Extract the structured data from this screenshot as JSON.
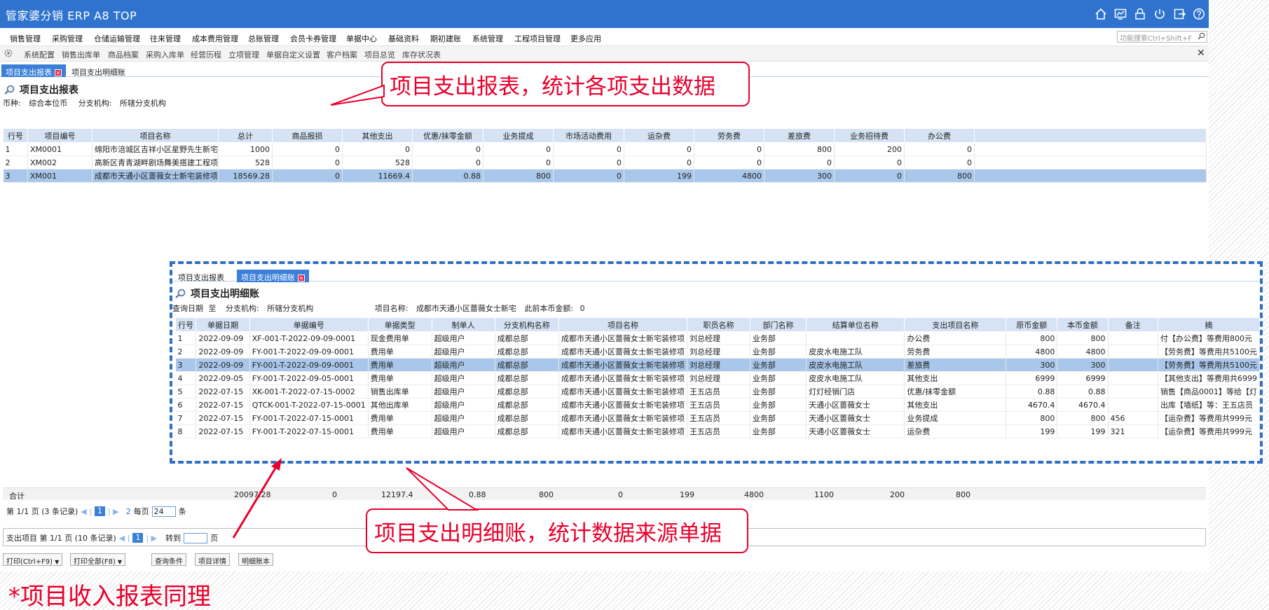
{
  "app": {
    "title": "管家婆分销 ERP A8 TOP"
  },
  "topbar_icons": [
    "home-icon",
    "chart-icon",
    "lock-icon",
    "power-icon",
    "logout-icon",
    "help-icon"
  ],
  "menu": [
    "销售管理",
    "采购管理",
    "仓储运输管理",
    "往来管理",
    "成本费用管理",
    "总账管理",
    "会员卡券管理",
    "单据中心",
    "基础资料",
    "期初建账",
    "系统管理",
    "工程项目管理",
    "更多应用"
  ],
  "search": {
    "placeholder": "功能搜索Ctrl+Shift+F"
  },
  "quickbar": [
    "系统配置",
    "销售出库单",
    "商品档案",
    "采购入库单",
    "经营历程",
    "立项管理",
    "单据自定义设置",
    "客户档案",
    "项目总览",
    "库存状况表"
  ],
  "tabs": [
    "项目支出报表",
    "项目支出明细账"
  ],
  "report": {
    "title": "项目支出报表",
    "filter": {
      "currency_label": "币种:",
      "currency": "综合本位币",
      "branch_label": "分支机构:",
      "branch": "所辖分支机构"
    },
    "columns": [
      "行号",
      "项目编号",
      "项目名称",
      "总计",
      "商品报损",
      "其他支出",
      "优惠/抹零金额",
      "业务提成",
      "市场活动费用",
      "运杂费",
      "劳务费",
      "差旅费",
      "业务招待费",
      "办公费"
    ],
    "rows": [
      [
        "1",
        "XM0001",
        "绵阳市涪城区吉祥小区星野先生新宅",
        "1000",
        "0",
        "0",
        "0",
        "0",
        "0",
        "0",
        "0",
        "800",
        "200",
        "0"
      ],
      [
        "2",
        "XM002",
        "高新区青青湖畔剧场舞美搭建工程项",
        "528",
        "0",
        "528",
        "0",
        "0",
        "0",
        "0",
        "0",
        "0",
        "0",
        "0"
      ],
      [
        "3",
        "XM001",
        "成都市天通小区蔷薇女士新宅装修项",
        "18569.28",
        "0",
        "11669.4",
        "0.88",
        "800",
        "0",
        "199",
        "4800",
        "300",
        "0",
        "800"
      ]
    ],
    "selected_row": 2,
    "totals": {
      "label": "合计",
      "total": "20097.28",
      "loss": "0",
      "other": "12197.4",
      "promo": "0.88",
      "commission": "800",
      "market": "0",
      "freight": "199",
      "labor": "4800",
      "travel": "1100",
      "entertain": "200",
      "office": "800"
    },
    "pager": {
      "page_text": "第 1/1 页 (3 条记录)",
      "page": "1",
      "refresh": "2",
      "per_page_label": "每页",
      "per_page": "24",
      "per_page_unit": "条"
    }
  },
  "detail": {
    "tabs": [
      "项目支出报表",
      "项目支出明细账"
    ],
    "title": "项目支出明细账",
    "filter": {
      "date_label": "查询日期",
      "date_to": "至",
      "branch_label": "分支机构:",
      "branch": "所辖分支机构",
      "project_label": "项目名称:",
      "project": "成都市天通小区蔷薇女士新宅",
      "prev_label": "此前本币金额:",
      "prev_amount": "0"
    },
    "columns": [
      "行号",
      "单据日期",
      "单据编号",
      "单据类型",
      "制单人",
      "分支机构名称",
      "项目名称",
      "职员名称",
      "部门名称",
      "结算单位名称",
      "支出项目名称",
      "原币金额",
      "本币金额",
      "备注",
      "摘"
    ],
    "rows": [
      [
        "1",
        "2022-09-09",
        "XF-001-T-2022-09-09-0001",
        "现金费用单",
        "超级用户",
        "成都总部",
        "成都市天通小区蔷薇女士新宅装修项",
        "刘总经理",
        "业务部",
        "",
        "办公费",
        "800",
        "800",
        "",
        "付【办公费】等费用800元"
      ],
      [
        "2",
        "2022-09-09",
        "FY-001-T-2022-09-09-0001",
        "费用单",
        "超级用户",
        "成都总部",
        "成都市天通小区蔷薇女士新宅装修项",
        "刘总经理",
        "业务部",
        "皮皮水电施工队",
        "劳务费",
        "4800",
        "4800",
        "",
        "【劳务费】等费用共5100元"
      ],
      [
        "3",
        "2022-09-09",
        "FY-001-T-2022-09-09-0001",
        "费用单",
        "超级用户",
        "成都总部",
        "成都市天通小区蔷薇女士新宅装修项",
        "刘总经理",
        "业务部",
        "皮皮水电施工队",
        "差旅费",
        "300",
        "300",
        "",
        "【劳务费】等费用共5100元"
      ],
      [
        "4",
        "2022-09-05",
        "FY-001-T-2022-09-05-0001",
        "费用单",
        "超级用户",
        "成都总部",
        "成都市天通小区蔷薇女士新宅装修项",
        "刘总经理",
        "业务部",
        "皮皮水电施工队",
        "其他支出",
        "6999",
        "6999",
        "",
        "【其他支出】等费用共6999"
      ],
      [
        "5",
        "2022-07-15",
        "XK-001-T-2022-07-15-0002",
        "销售出库单",
        "超级用户",
        "成都总部",
        "成都市天通小区蔷薇女士新宅装修项",
        "王五店员",
        "业务部",
        "灯灯经销门店",
        "优惠/抹零金额",
        "0.88",
        "0.88",
        "",
        "销售【商品0001】等给【灯"
      ],
      [
        "6",
        "2022-07-15",
        "QTCK-001-T-2022-07-15-0001",
        "其他出库单",
        "超级用户",
        "成都总部",
        "成都市天通小区蔷薇女士新宅装修项",
        "王五店员",
        "业务部",
        "天通小区蔷薇女士",
        "其他支出",
        "4670.4",
        "4670.4",
        "",
        "出库【墙纸】等：王五店员"
      ],
      [
        "7",
        "2022-07-15",
        "FY-001-T-2022-07-15-0001",
        "费用单",
        "超级用户",
        "成都总部",
        "成都市天通小区蔷薇女士新宅装修项",
        "王五店员",
        "业务部",
        "天通小区蔷薇女士",
        "业务提成",
        "800",
        "800",
        "456",
        "【运杂费】等费用共999元"
      ],
      [
        "8",
        "2022-07-15",
        "FY-001-T-2022-07-15-0001",
        "费用单",
        "超级用户",
        "成都总部",
        "成都市天通小区蔷薇女士新宅装修项",
        "王五店员",
        "业务部",
        "天通小区蔷薇女士",
        "运杂费",
        "199",
        "199",
        "321",
        "【运杂费】等费用共999元"
      ]
    ],
    "selected_row": 2,
    "pager": {
      "label": "支出项目 第 1/1 页 (10 条记录)",
      "page": "1",
      "goto_label": "转到",
      "goto_unit": "页"
    }
  },
  "buttons": {
    "print": "打印(Ctrl+F9)",
    "print_all": "打印全部(F8)",
    "query": "查询条件",
    "project_detail": "项目详情",
    "ledger": "明细账本"
  },
  "callouts": {
    "top": "项目支出报表，统计各项支出数据",
    "bottom": "项目支出明细账，统计数据来源单据"
  },
  "note": "*项目收入报表同理",
  "colors": {
    "titlebar": "#2f73cf",
    "accent": "#3a7fd8",
    "header_row": "#d5e3f4",
    "selected_row": "#a9c7ea",
    "annotation": "#e8002c",
    "dashed_border": "#2f6fc4"
  }
}
